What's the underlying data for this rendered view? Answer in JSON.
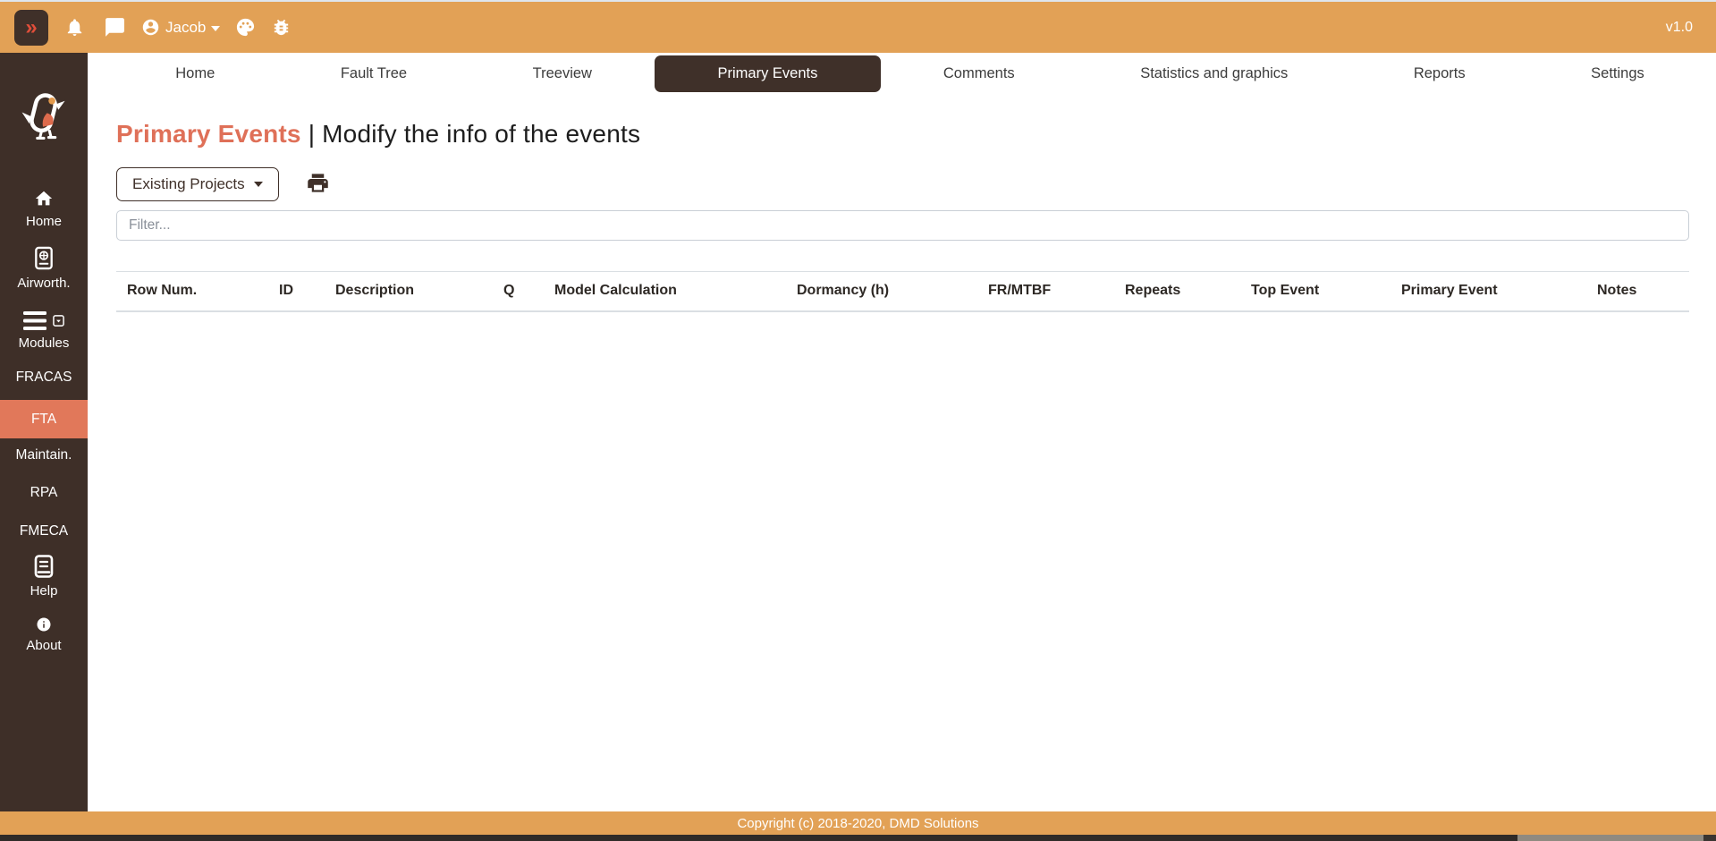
{
  "topbar": {
    "collapse_glyph": "»",
    "user": "Jacob",
    "version": "v1.0"
  },
  "icons": {
    "collapse": "double-chevron-right",
    "notifications": "bell",
    "messages": "chat-bubble",
    "account": "user-circle",
    "theme": "palette",
    "debug": "bug",
    "print": "printer",
    "home": "house",
    "airworthiness": "passport-globe",
    "modules": "hamburger-menu",
    "modules_toggle": "boxed-caret-down",
    "help": "book",
    "about": "info-circle",
    "logo": "robin-bird"
  },
  "sidebar": {
    "items": [
      "Home",
      "Airworth.",
      "Modules",
      "FRACAS",
      "FTA",
      "Maintain.",
      "RPA",
      "FMECA",
      "Help",
      "About"
    ],
    "active_item": "FTA"
  },
  "tabs": {
    "items": [
      "Home",
      "Fault Tree",
      "Treeview",
      "Primary Events",
      "Comments",
      "Statistics and graphics",
      "Reports",
      "Settings"
    ],
    "active": "Primary Events"
  },
  "heading": {
    "title": "Primary Events",
    "separator": "|",
    "subtitle": "Modify the info of the events"
  },
  "toolbar": {
    "projects_label": "Existing Projects"
  },
  "filter": {
    "placeholder": "Filter...",
    "value": ""
  },
  "table": {
    "headers": [
      "Row Num.",
      "ID",
      "Description",
      "Q",
      "Model Calculation",
      "Dormancy (h)",
      "FR/MTBF",
      "Repeats",
      "Top Event",
      "Primary Event",
      "Notes"
    ],
    "rows": []
  },
  "footer": {
    "copyright": "Copyright (c) 2018-2020, DMD Solutions"
  },
  "colors": {
    "accent_orange": "#E2A156",
    "sidebar_brown": "#3E2F28",
    "dark_brown": "#3F3029",
    "salmon_active": "#E1785A",
    "heading_salmon": "#DF7058",
    "chevron_red": "#E04E3A"
  }
}
